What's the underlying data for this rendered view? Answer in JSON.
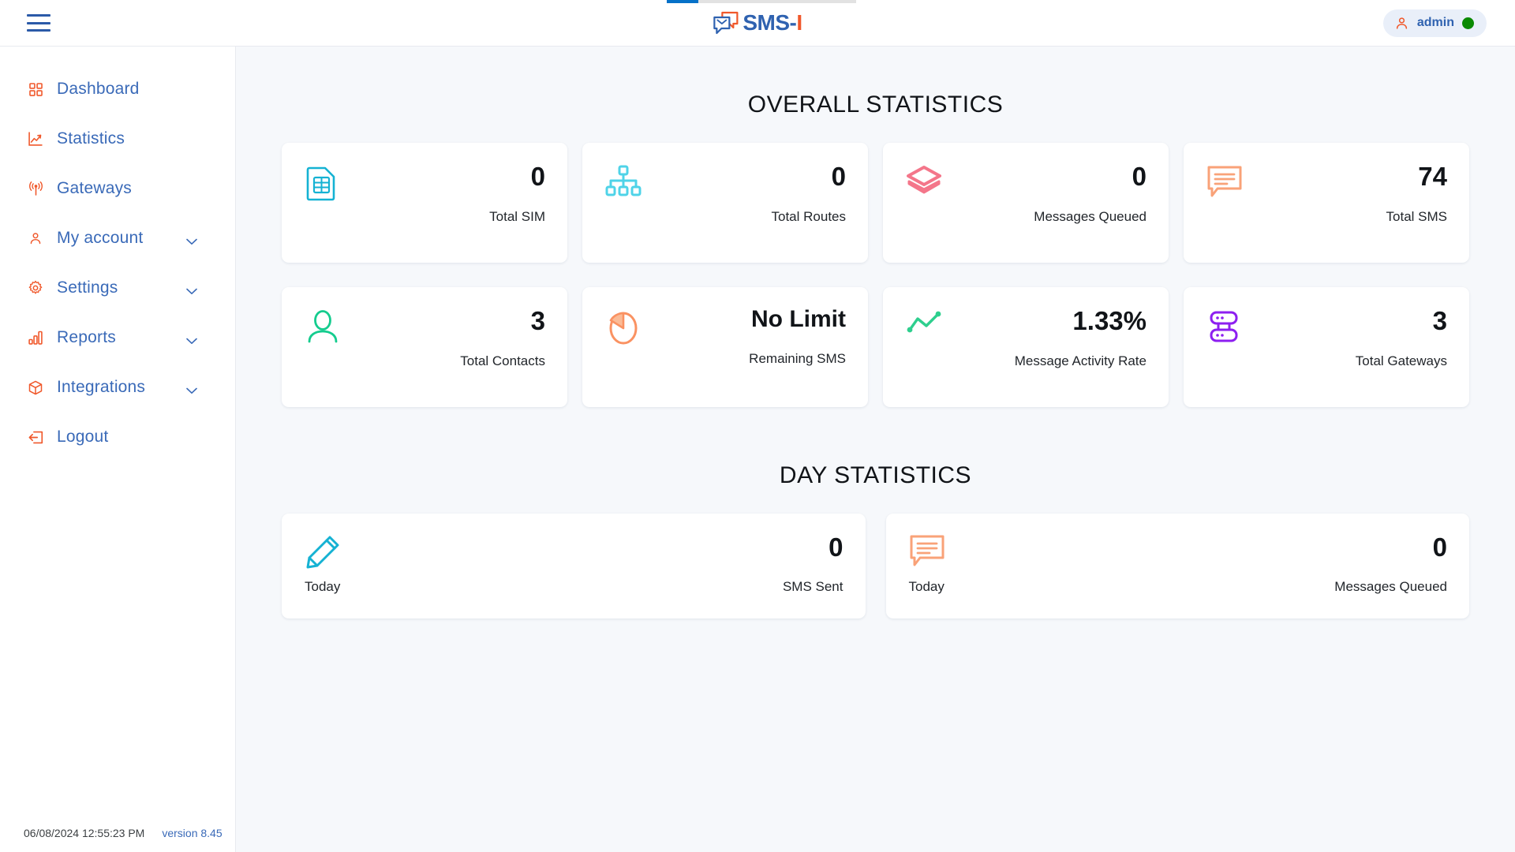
{
  "header": {
    "menu_icon": "hamburger-icon",
    "logo_main": "SMS-",
    "logo_accent": "I",
    "user_icon": "user-icon",
    "username": "admin",
    "status": "online"
  },
  "loader": {
    "progress": 17
  },
  "sidebar": {
    "items": [
      {
        "label": "Dashboard",
        "icon": "grid-icon",
        "expandable": false
      },
      {
        "label": "Statistics",
        "icon": "trend-chart-icon",
        "expandable": false
      },
      {
        "label": "Gateways",
        "icon": "antenna-icon",
        "expandable": false
      },
      {
        "label": "My account",
        "icon": "user-icon",
        "expandable": true
      },
      {
        "label": "Settings",
        "icon": "gear-icon",
        "expandable": true
      },
      {
        "label": "Reports",
        "icon": "bar-chart-icon",
        "expandable": true
      },
      {
        "label": "Integrations",
        "icon": "cube-icon",
        "expandable": true
      },
      {
        "label": "Logout",
        "icon": "logout-icon",
        "expandable": false
      }
    ]
  },
  "footer": {
    "timestamp": "06/08/2024 12:55:23 PM",
    "version": "version 8.45"
  },
  "main": {
    "overall_title": "OVERALL STATISTICS",
    "day_title": "DAY STATISTICS",
    "overall_cards": [
      {
        "value": "0",
        "label": "Total SIM",
        "icon": "sim-card-icon",
        "color": "#15b2d3"
      },
      {
        "value": "0",
        "label": "Total Routes",
        "icon": "sitemap-icon",
        "color": "#4fd3e8"
      },
      {
        "value": "0",
        "label": "Messages Queued",
        "icon": "layers-icon",
        "color": "#f4768a"
      },
      {
        "value": "74",
        "label": "Total SMS",
        "icon": "chat-lines-icon",
        "color": "#f9a278"
      },
      {
        "value": "3",
        "label": "Total Contacts",
        "icon": "person-icon",
        "color": "#14cc8e"
      },
      {
        "value": "No Limit",
        "label": "Remaining SMS",
        "icon": "pie-chart-icon",
        "color": "#fa9262"
      },
      {
        "value": "1.33%",
        "label": "Message Activity Rate",
        "icon": "line-chart-icon",
        "color": "#2ecf8e"
      },
      {
        "value": "3",
        "label": "Total Gateways",
        "icon": "server-icon",
        "color": "#8d1ff0"
      }
    ],
    "day_cards": [
      {
        "left_label": "Today",
        "value": "0",
        "right_label": "SMS Sent",
        "icon": "pencil-icon",
        "color": "#15b2d3"
      },
      {
        "left_label": "Today",
        "value": "0",
        "right_label": "Messages Queued",
        "icon": "chat-lines-icon",
        "color": "#f9a278"
      }
    ]
  },
  "colors": {
    "brand_blue": "#2f62b0",
    "brand_orange": "#f0582b",
    "bg": "#f6f8fb"
  }
}
